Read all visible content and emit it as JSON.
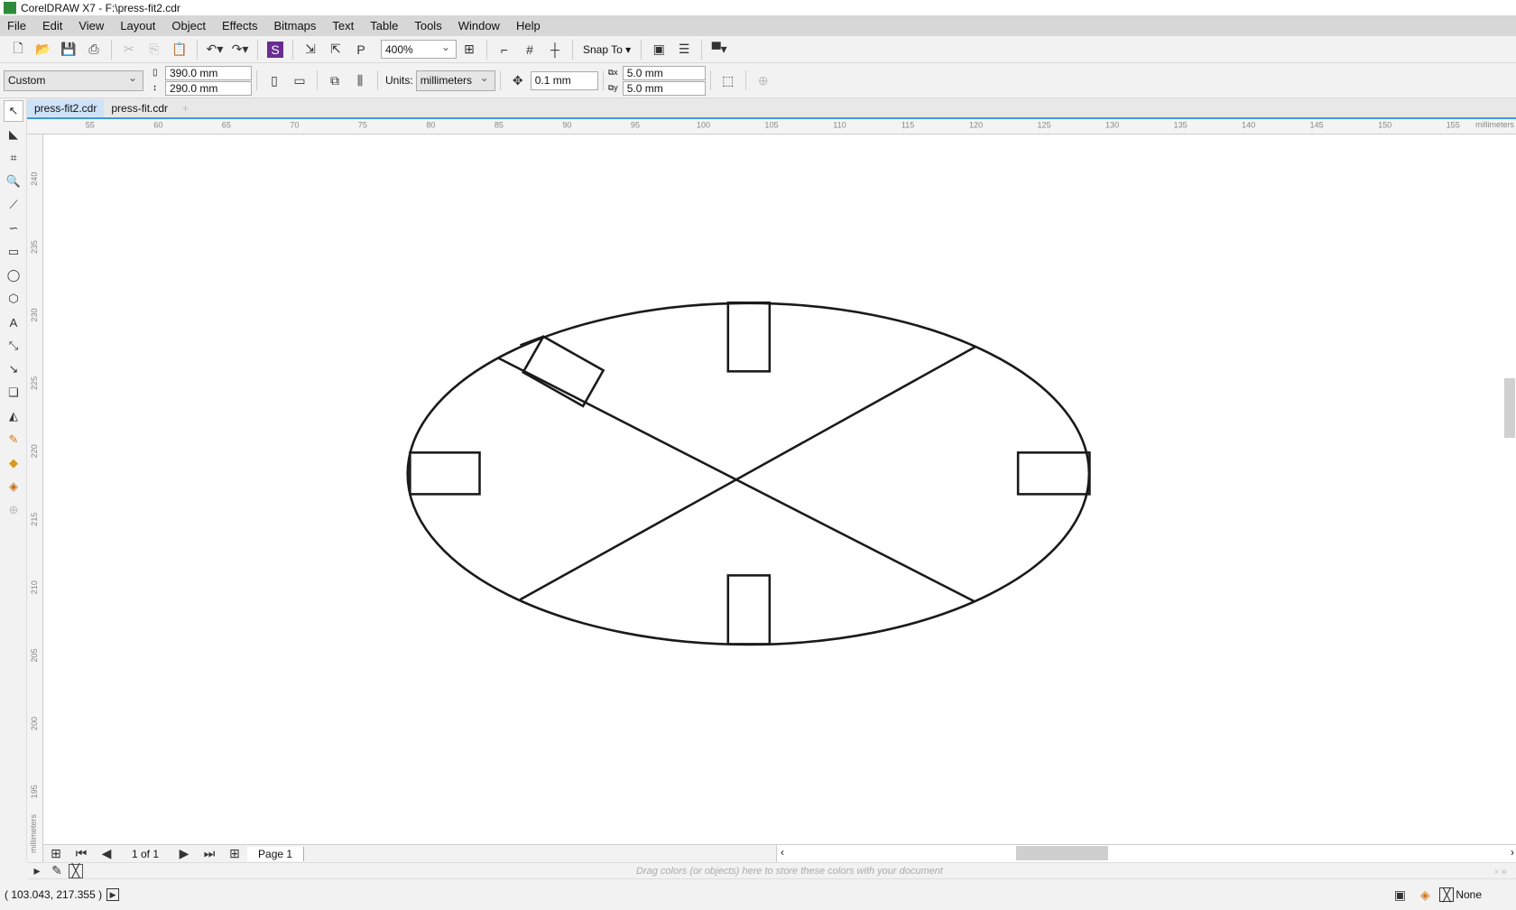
{
  "window": {
    "title": "CorelDRAW X7 - F:\\press-fit2.cdr"
  },
  "menu": [
    "File",
    "Edit",
    "View",
    "Layout",
    "Object",
    "Effects",
    "Bitmaps",
    "Text",
    "Table",
    "Tools",
    "Window",
    "Help"
  ],
  "toolbar": {
    "zoom": "400%",
    "snap_to": "Snap To"
  },
  "property_bar": {
    "page_preset": "Custom",
    "width": "390.0 mm",
    "height": "290.0 mm",
    "units_label": "Units:",
    "units": "millimeters",
    "nudge": "0.1 mm",
    "dup_x": "5.0 mm",
    "dup_y": "5.0 mm"
  },
  "tabs": [
    {
      "label": "press-fit2.cdr",
      "active": true
    },
    {
      "label": "press-fit.cdr",
      "active": false
    }
  ],
  "rulers": {
    "unit": "millimeters",
    "h_ticks": [
      "55",
      "60",
      "65",
      "70",
      "75",
      "80",
      "85",
      "90",
      "95",
      "100",
      "105",
      "110",
      "115",
      "120",
      "125",
      "130",
      "135",
      "140",
      "145",
      "150",
      "155"
    ],
    "v_ticks": [
      "240",
      "235",
      "230",
      "225",
      "220",
      "215",
      "210",
      "205",
      "200",
      "195"
    ]
  },
  "page_nav": {
    "count": "1 of 1",
    "page": "Page 1"
  },
  "palette": {
    "hint": "Drag colors (or objects) here to store these colors with your document"
  },
  "status": {
    "coords": "( 103.043, 217.355 )",
    "fill": "None"
  }
}
